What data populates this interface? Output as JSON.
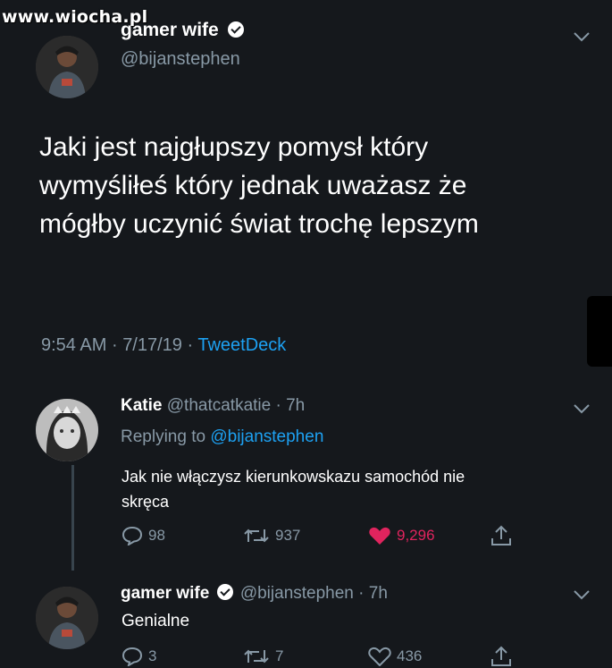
{
  "watermark": "www.wiocha.pl",
  "main_tweet": {
    "display_name": "gamer wife",
    "handle": "@bijanstephen",
    "text_lines": [
      "Jaki jest najgłupszy pomysł który",
      "wymyśliłeś który jednak uważasz że",
      "mógłby uczynić świat trochę lepszym"
    ],
    "time": "9:54 AM",
    "date": "7/17/19",
    "separator": "·",
    "source": "TweetDeck"
  },
  "reply1": {
    "display_name": "Katie",
    "handle": "@thatcatkatie",
    "age": "· 7h",
    "replying_prefix": "Replying to ",
    "replying_to": "@bijanstephen",
    "text_lines": [
      "Jak nie włączysz kierunkowskazu samochód nie",
      "skręca"
    ],
    "replies": "98",
    "retweets": "937",
    "likes": "9,296"
  },
  "reply2": {
    "display_name": "gamer wife",
    "handle": "@bijanstephen",
    "age": "· 7h",
    "text": "Genialne",
    "replies": "3",
    "retweets": "7",
    "likes": "436"
  },
  "colors": {
    "background": "#15181c",
    "muted": "#8899a6",
    "link": "#1da1f2",
    "like": "#e0245e"
  },
  "icons": [
    "verified-badge-icon",
    "chevron-down-icon",
    "reply-icon",
    "retweet-icon",
    "heart-icon",
    "share-icon"
  ]
}
